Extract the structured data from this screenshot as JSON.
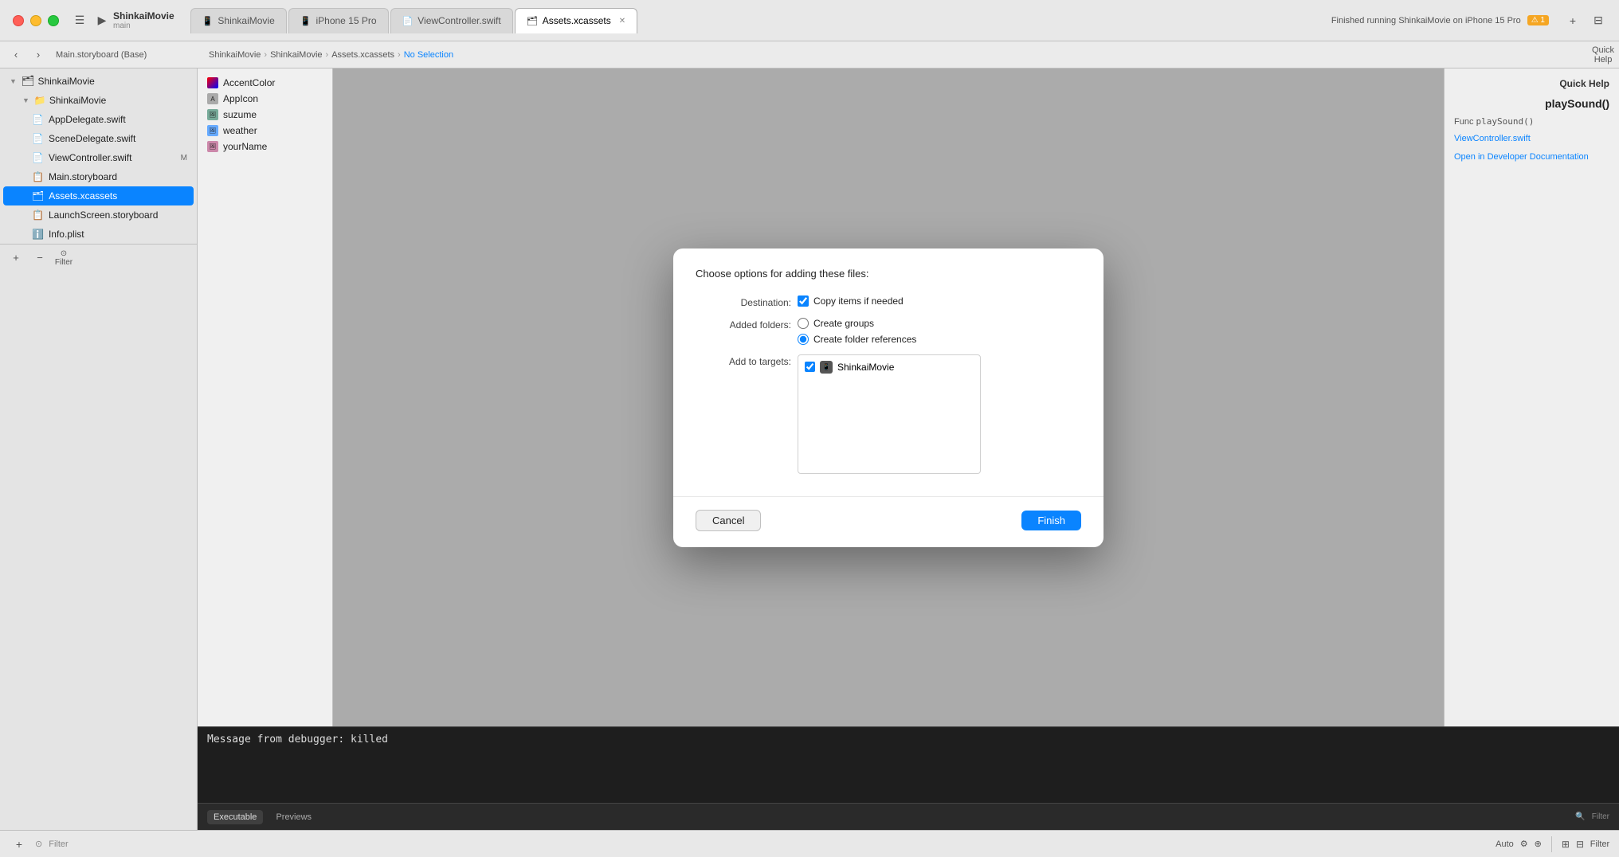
{
  "titlebar": {
    "project_name": "ShinkaiMovie",
    "project_sub": "main",
    "tabs": [
      {
        "label": "ShinkaiMovie",
        "icon": "📱",
        "active": false
      },
      {
        "label": "iPhone 15 Pro",
        "icon": "📱",
        "active": false
      },
      {
        "label": "ViewController.swift",
        "icon": "📄",
        "active": false
      },
      {
        "label": "Assets.xcassets",
        "icon": "🗂",
        "active": true
      }
    ],
    "status": "Finished running ShinkaiMovie on iPhone 15 Pro",
    "warning_count": "1"
  },
  "toolbar": {
    "breadcrumb": [
      "ShinkaiMovie",
      "ShinkaiMovie",
      "Assets.xcassets",
      "No Selection"
    ],
    "back_label": "‹",
    "forward_label": "›"
  },
  "sidebar": {
    "project_label": "ShinkaiMovie",
    "items": [
      {
        "label": "ShinkaiMovie",
        "level": 0,
        "icon": "📁",
        "expanded": true
      },
      {
        "label": "ShinkaiMovie",
        "level": 1,
        "icon": "📁",
        "expanded": true
      },
      {
        "label": "AppDelegate.swift",
        "level": 2,
        "icon": "📄",
        "selected": false
      },
      {
        "label": "SceneDelegate.swift",
        "level": 2,
        "icon": "📄",
        "selected": false
      },
      {
        "label": "ViewController.swift",
        "level": 2,
        "icon": "📄",
        "selected": false
      },
      {
        "label": "Main.storyboard",
        "level": 2,
        "icon": "📋",
        "selected": false
      },
      {
        "label": "Assets.xcassets",
        "level": 2,
        "icon": "🗂",
        "selected": true
      },
      {
        "label": "LaunchScreen.storyboard",
        "level": 2,
        "icon": "📋",
        "selected": false
      },
      {
        "label": "Info.plist",
        "level": 2,
        "icon": "ℹ️",
        "selected": false
      }
    ],
    "add_button": "+",
    "filter_placeholder": "Filter"
  },
  "file_browser": {
    "items": [
      {
        "label": "AccentColor",
        "icon": "color"
      },
      {
        "label": "AppIcon",
        "icon": "icon"
      },
      {
        "label": "suzume",
        "icon": "img"
      },
      {
        "label": "weather",
        "icon": "img"
      },
      {
        "label": "yourName",
        "icon": "img"
      }
    ]
  },
  "modal": {
    "title": "Choose options for adding these files:",
    "destination_label": "Destination:",
    "destination_checked": true,
    "copy_items_label": "Copy items if needed",
    "added_folders_label": "Added folders:",
    "create_groups_label": "Create groups",
    "create_folder_refs_label": "Create folder references",
    "add_to_targets_label": "Add to targets:",
    "target_name": "ShinkaiMovie",
    "cancel_label": "Cancel",
    "finish_label": "Finish"
  },
  "right_panel": {
    "header": "Quick Help",
    "function_name": "playSound()",
    "func_label": "Func",
    "func_signature": "playSound()",
    "source_file": "ViewController.swift",
    "docs_link": "Open in Developer Documentation"
  },
  "debug": {
    "message": "Message from debugger: killed"
  },
  "bottom_bar": {
    "auto_label": "Auto",
    "filter_placeholder": "Filter",
    "tabs": [
      "Executable",
      "Previews"
    ],
    "active_tab": "Executable"
  }
}
